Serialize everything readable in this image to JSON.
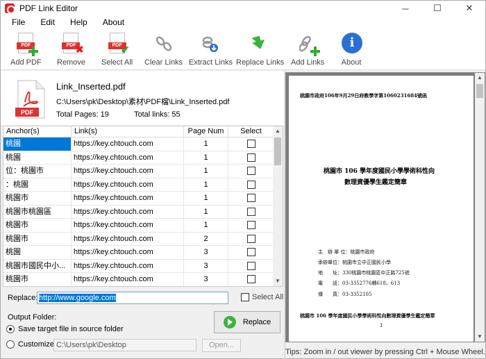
{
  "window": {
    "title": "PDF Link Editor",
    "minimize": "─",
    "maximize": "☐",
    "close": "✕"
  },
  "menu": [
    "File",
    "Edit",
    "Help",
    "About"
  ],
  "toolbar": {
    "add_pdf": "Add PDF",
    "remove": "Remove",
    "select_all": "Select All",
    "clear_links": "Clear Links",
    "extract_links": "Extract Links",
    "replace_links": "Replace Links",
    "add_links": "Add Links",
    "about": "About"
  },
  "file": {
    "name": "Link_Inserted.pdf",
    "path": "C:\\Users\\pk\\Desktop\\素材\\PDF檔\\Link_Inserted.pdf",
    "total_pages": "Total Pages: 19",
    "total_links": "Total links: 55",
    "icon_label": "PDF"
  },
  "table": {
    "headers": [
      "Anchor(s)",
      "Link(s)",
      "Page Num",
      "Select"
    ],
    "rows": [
      {
        "anchor": "桃園",
        "link": "https://key.chtouch.com",
        "page": "1"
      },
      {
        "anchor": "桃園",
        "link": "https://key.chtouch.com",
        "page": "1"
      },
      {
        "anchor": "位：桃園市",
        "link": "https://key.chtouch.com",
        "page": "1"
      },
      {
        "anchor": "：桃園",
        "link": "https://key.chtouch.com",
        "page": "1"
      },
      {
        "anchor": "桃園市",
        "link": "https://key.chtouch.com",
        "page": "1"
      },
      {
        "anchor": "桃園市桃園區",
        "link": "https://key.chtouch.com",
        "page": "1"
      },
      {
        "anchor": "桃園市",
        "link": "https://key.chtouch.com",
        "page": "1"
      },
      {
        "anchor": "桃園市",
        "link": "https://key.chtouch.com",
        "page": "2"
      },
      {
        "anchor": "桃園",
        "link": "https://key.chtouch.com",
        "page": "3"
      },
      {
        "anchor": "桃園市國民中小...",
        "link": "https://key.chtouch.com",
        "page": "3"
      },
      {
        "anchor": "桃園市",
        "link": "https://key.chtouch.com",
        "page": "3"
      }
    ]
  },
  "replace": {
    "label": "Replace:",
    "value": "http://www.google.com",
    "select_all": "Select All",
    "button": "Replace"
  },
  "output": {
    "label": "Output Folder:",
    "option_source": "Save target file in source folder",
    "option_custom": "Customize:",
    "custom_path": "C:\\Users\\pk\\Desktop",
    "open_button": "Open..."
  },
  "viewer": {
    "header": "桃園市政府106年9月29日府教學字第1060231684號函",
    "title_line1": "桃園市 106 學年度國民小學學術科性向",
    "title_line2": "數理資優學生鑑定簡章",
    "info_lines": [
      "主　辦 單 位：桃園市政府",
      "承辦單位：桃園市立中正國民小學",
      "地　　址：330桃園市桃園區中正路725號",
      "電　　話：03-3352776轉618、613",
      "傳　　真：03-3352105"
    ],
    "footer": "桃園市 106 學年度國民小學學術科性向數理資優學生鑑定簡章",
    "page_mark": "1"
  },
  "tips": "Tips: Zoom in / out viewer by pressing Ctrl + Mouse Wheel.",
  "colors": {
    "selection": "#0078d7",
    "pdf_red": "#d33333",
    "green": "#3bb33b",
    "info_blue": "#2a6fd4"
  }
}
